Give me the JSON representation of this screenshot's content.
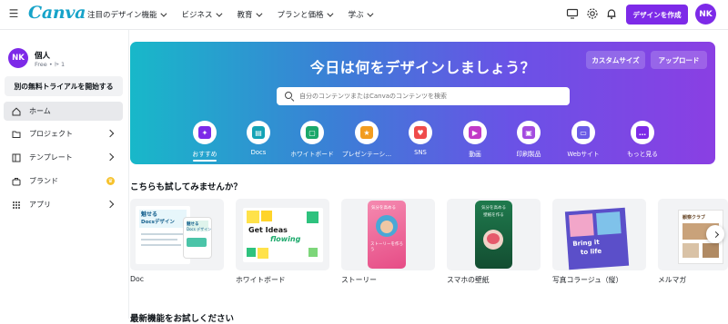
{
  "app": {
    "logo": "Canva"
  },
  "topnav": {
    "items": [
      "注目のデザイン機能",
      "ビジネス",
      "教育",
      "プランと価格",
      "学ぶ"
    ]
  },
  "header": {
    "design_button": "デザインを作成",
    "avatar_initials": "NK"
  },
  "sidebar": {
    "user": {
      "initials": "NK",
      "name": "個人",
      "sub": "Free • ⩥ 1"
    },
    "trial_button": "別の無料トライアルを開始する",
    "items": [
      {
        "label": "ホーム",
        "icon": "home-icon"
      },
      {
        "label": "プロジェクト",
        "icon": "folder-icon"
      },
      {
        "label": "テンプレート",
        "icon": "template-icon"
      },
      {
        "label": "ブランド",
        "icon": "brand-icon"
      },
      {
        "label": "アプリ",
        "icon": "apps-icon"
      }
    ]
  },
  "hero": {
    "title": "今日は何をデザインしましょう？",
    "custom_size_button": "カスタムサイズ",
    "upload_button": "アップロード",
    "search_placeholder": "自分のコンテンツまたはCanvaのコンテンツを検索",
    "categories": [
      {
        "label": "おすすめ",
        "icon": "sparkle-icon",
        "color": "#7d2ae8"
      },
      {
        "label": "Docs",
        "icon": "docs-icon",
        "color": "#13a3b5"
      },
      {
        "label": "ホワイトボード",
        "icon": "whiteboard-icon",
        "color": "#1aa86a"
      },
      {
        "label": "プレゼンテーシ…",
        "icon": "presentation-icon",
        "color": "#f29c1f"
      },
      {
        "label": "SNS",
        "icon": "social-icon",
        "color": "#ef4b4b"
      },
      {
        "label": "動画",
        "icon": "video-icon",
        "color": "#c23ac7"
      },
      {
        "label": "印刷製品",
        "icon": "print-icon",
        "color": "#a44be0"
      },
      {
        "label": "Webサイト",
        "icon": "website-icon",
        "color": "#6b5ce7"
      },
      {
        "label": "もっと見る",
        "icon": "more-icon",
        "color": "#7d2ae8"
      }
    ]
  },
  "try_section": {
    "title": "こちらも試してみませんか？",
    "cards": [
      {
        "label": "Doc"
      },
      {
        "label": "ホワイトボード"
      },
      {
        "label": "ストーリー"
      },
      {
        "label": "スマホの壁紙"
      },
      {
        "label": "写真コラージュ（縦）"
      },
      {
        "label": "メルマガ"
      }
    ],
    "card_texts": {
      "doc_a": "魅せる",
      "doc_b": "Docsデザイン",
      "doc_c": "魅せる",
      "doc_d": "Docs デザイン",
      "wb_a": "Get Ideas",
      "wb_b": "flowing",
      "story_a": "気分を高める",
      "story_b": "ストーリーを作ろう",
      "phone_a": "気分を高める",
      "phone_b": "壁紙を作る",
      "collage_a": "Bring it",
      "collage_b": "to life",
      "mag_a": "観察クラブ"
    }
  },
  "bottom_section": {
    "title": "最新機能をお試しください"
  }
}
